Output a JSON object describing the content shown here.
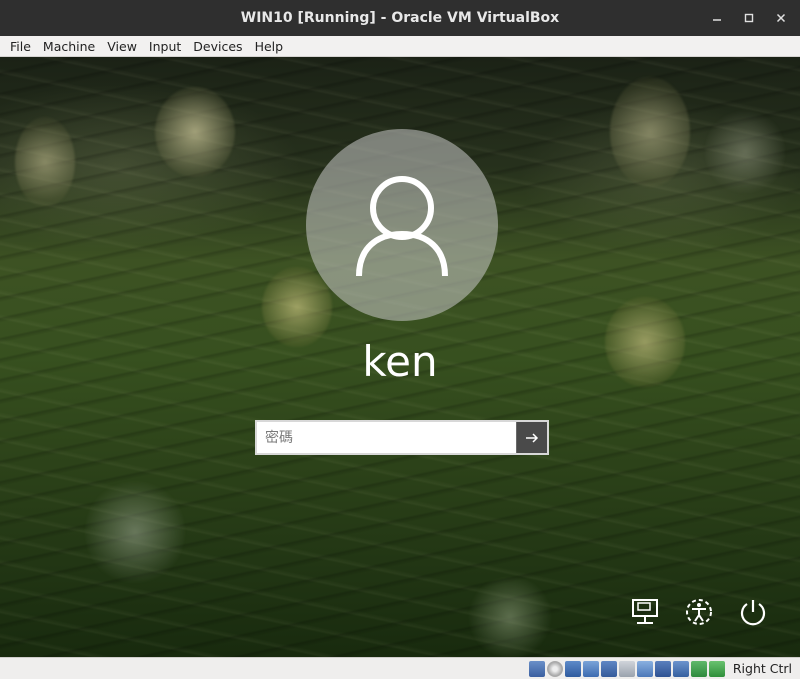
{
  "window": {
    "title": "WIN10 [Running] - Oracle VM VirtualBox"
  },
  "menu": {
    "items": [
      "File",
      "Machine",
      "View",
      "Input",
      "Devices",
      "Help"
    ]
  },
  "login": {
    "username": "ken",
    "password_placeholder": "密碼"
  },
  "status": {
    "host_key": "Right Ctrl"
  },
  "colors": {
    "titlebar": "#2f2f2f",
    "menubar": "#f2f1f0",
    "submit_button": "#4a4a4a"
  }
}
